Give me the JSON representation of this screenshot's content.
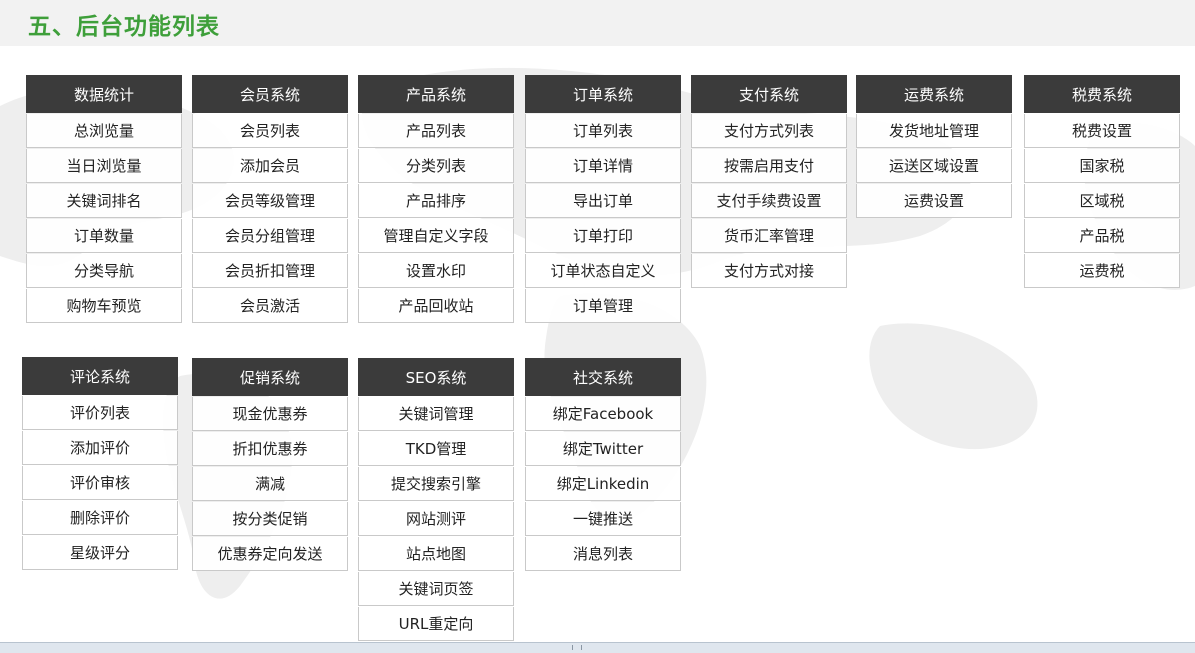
{
  "title": "五、后台功能列表",
  "row1": [
    {
      "head": "数据统计",
      "items": [
        "总浏览量",
        "当日浏览量",
        "关键词排名",
        "订单数量",
        "分类导航",
        "购物车预览"
      ]
    },
    {
      "head": "会员系统",
      "items": [
        "会员列表",
        "添加会员",
        "会员等级管理",
        "会员分组管理",
        "会员折扣管理",
        "会员激活"
      ]
    },
    {
      "head": "产品系统",
      "items": [
        "产品列表",
        "分类列表",
        "产品排序",
        "管理自定义字段",
        "设置水印",
        "产品回收站"
      ]
    },
    {
      "head": "订单系统",
      "items": [
        "订单列表",
        "订单详情",
        "导出订单",
        "订单打印",
        "订单状态自定义",
        "订单管理"
      ]
    },
    {
      "head": "支付系统",
      "items": [
        "支付方式列表",
        "按需启用支付",
        "支付手续费设置",
        "货币汇率管理",
        "支付方式对接"
      ]
    },
    {
      "head": "运费系统",
      "items": [
        "发货地址管理",
        "运送区域设置",
        "运费设置"
      ]
    },
    {
      "head": "税费系统",
      "items": [
        "税费设置",
        "国家税",
        "区域税",
        "产品税",
        "运费税"
      ]
    }
  ],
  "row2": [
    {
      "head": "评论系统",
      "items": [
        "评价列表",
        "添加评价",
        "评价审核",
        "删除评价",
        "星级评分"
      ]
    },
    {
      "head": "促销系统",
      "items": [
        "现金优惠券",
        "折扣优惠券",
        "满减",
        "按分类促销",
        "优惠券定向发送"
      ]
    },
    {
      "head": "SEO系统",
      "items": [
        "关键词管理",
        "TKD管理",
        "提交搜索引擎",
        "网站测评",
        "站点地图",
        "关键词页签",
        "URL重定向"
      ]
    },
    {
      "head": "社交系统",
      "items": [
        "绑定Facebook",
        "绑定Twitter",
        "绑定Linkedin",
        "一键推送",
        "消息列表"
      ]
    }
  ]
}
